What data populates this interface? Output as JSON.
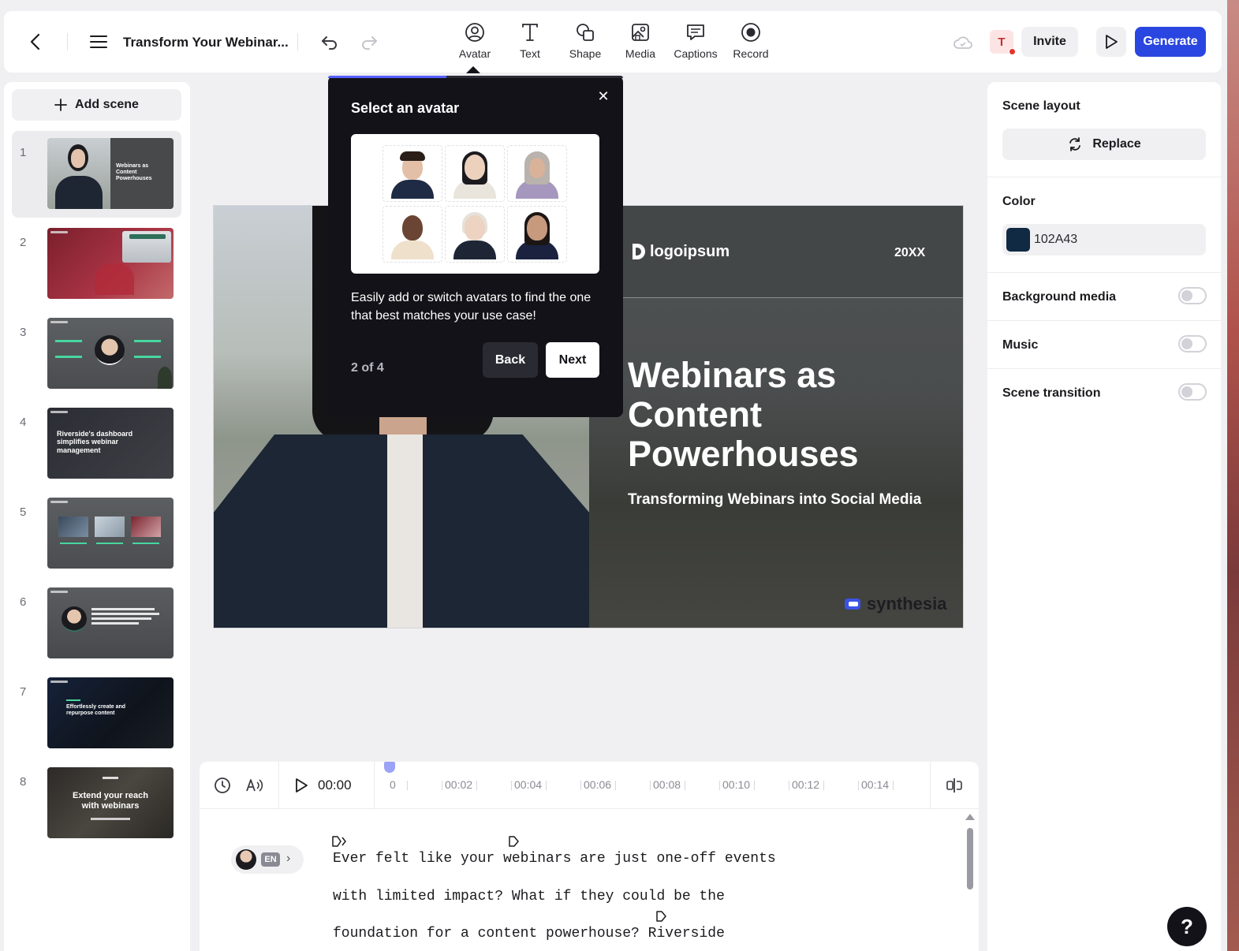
{
  "topbar": {
    "title": "Transform Your Webinar...",
    "tools": [
      {
        "label": "Avatar",
        "icon": "avatar-icon"
      },
      {
        "label": "Text",
        "icon": "text-icon"
      },
      {
        "label": "Shape",
        "icon": "shape-icon"
      },
      {
        "label": "Media",
        "icon": "media-icon"
      },
      {
        "label": "Captions",
        "icon": "captions-icon"
      },
      {
        "label": "Record",
        "icon": "record-icon"
      }
    ],
    "user_initial": "T",
    "invite_label": "Invite",
    "generate_label": "Generate",
    "generate_color": "#2a46e0"
  },
  "scenes_panel": {
    "add_scene_label": "Add scene",
    "scenes": [
      {
        "number": "1",
        "caption": "Webinars as Content Powerhouses"
      },
      {
        "number": "2",
        "caption": ""
      },
      {
        "number": "3",
        "caption": ""
      },
      {
        "number": "4",
        "caption": "Riverside's dashboard simplifies webinar management"
      },
      {
        "number": "5",
        "caption": ""
      },
      {
        "number": "6",
        "caption": ""
      },
      {
        "number": "7",
        "caption": "Effortlessly create and repurpose content"
      },
      {
        "number": "8",
        "caption": "Extend your reach with webinars"
      }
    ],
    "active_scene": 1
  },
  "canvas": {
    "logo_text": "logoipsum",
    "year": "20XX",
    "title": "Webinars as Content Powerhouses",
    "subtitle": "Transforming Webinars into Social Media",
    "watermark": "synthesia"
  },
  "popup": {
    "title": "Select an avatar",
    "description": "Easily add or switch avatars to find the one that best matches your use case!",
    "step": "2 of 4",
    "progress": 0.4,
    "back_label": "Back",
    "next_label": "Next"
  },
  "right_panel": {
    "scene_layout_label": "Scene layout",
    "replace_label": "Replace",
    "color_label": "Color",
    "color_hex": "102A43",
    "color_value": "#102A43",
    "background_media_label": "Background media",
    "background_media_on": false,
    "music_label": "Music",
    "music_on": false,
    "scene_transition_label": "Scene transition",
    "scene_transition_on": false
  },
  "timeline": {
    "current_time": "00:00",
    "marks": [
      "0",
      "00:02",
      "00:04",
      "00:06",
      "00:08",
      "00:10",
      "00:12",
      "00:14"
    ],
    "language": "EN",
    "script_lines": [
      "Ever felt like your webinars are just one-off events",
      "with limited impact? What if they could be the",
      "foundation for a content powerhouse? Riverside"
    ]
  },
  "help_label": "?"
}
